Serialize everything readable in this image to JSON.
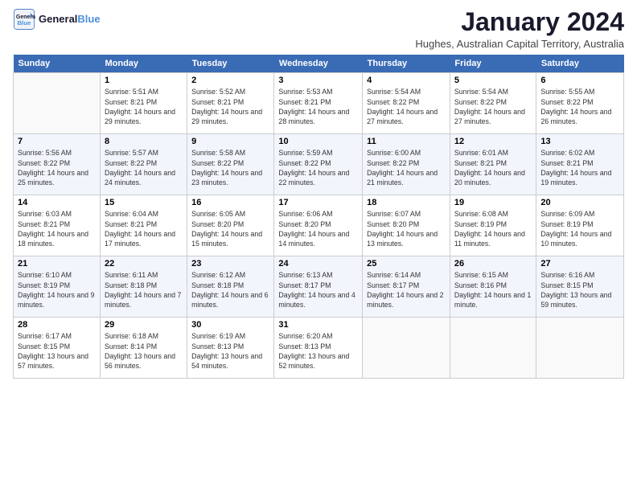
{
  "logo": {
    "text_general": "General",
    "text_blue": "Blue"
  },
  "header": {
    "title": "January 2024",
    "subtitle": "Hughes, Australian Capital Territory, Australia"
  },
  "weekdays": [
    "Sunday",
    "Monday",
    "Tuesday",
    "Wednesday",
    "Thursday",
    "Friday",
    "Saturday"
  ],
  "weeks": [
    [
      {
        "day": "",
        "empty": true
      },
      {
        "day": "1",
        "sunrise": "5:51 AM",
        "sunset": "8:21 PM",
        "daylight": "14 hours and 29 minutes."
      },
      {
        "day": "2",
        "sunrise": "5:52 AM",
        "sunset": "8:21 PM",
        "daylight": "14 hours and 29 minutes."
      },
      {
        "day": "3",
        "sunrise": "5:53 AM",
        "sunset": "8:21 PM",
        "daylight": "14 hours and 28 minutes."
      },
      {
        "day": "4",
        "sunrise": "5:54 AM",
        "sunset": "8:22 PM",
        "daylight": "14 hours and 27 minutes."
      },
      {
        "day": "5",
        "sunrise": "5:54 AM",
        "sunset": "8:22 PM",
        "daylight": "14 hours and 27 minutes."
      },
      {
        "day": "6",
        "sunrise": "5:55 AM",
        "sunset": "8:22 PM",
        "daylight": "14 hours and 26 minutes."
      }
    ],
    [
      {
        "day": "7",
        "sunrise": "5:56 AM",
        "sunset": "8:22 PM",
        "daylight": "14 hours and 25 minutes."
      },
      {
        "day": "8",
        "sunrise": "5:57 AM",
        "sunset": "8:22 PM",
        "daylight": "14 hours and 24 minutes."
      },
      {
        "day": "9",
        "sunrise": "5:58 AM",
        "sunset": "8:22 PM",
        "daylight": "14 hours and 23 minutes."
      },
      {
        "day": "10",
        "sunrise": "5:59 AM",
        "sunset": "8:22 PM",
        "daylight": "14 hours and 22 minutes."
      },
      {
        "day": "11",
        "sunrise": "6:00 AM",
        "sunset": "8:22 PM",
        "daylight": "14 hours and 21 minutes."
      },
      {
        "day": "12",
        "sunrise": "6:01 AM",
        "sunset": "8:21 PM",
        "daylight": "14 hours and 20 minutes."
      },
      {
        "day": "13",
        "sunrise": "6:02 AM",
        "sunset": "8:21 PM",
        "daylight": "14 hours and 19 minutes."
      }
    ],
    [
      {
        "day": "14",
        "sunrise": "6:03 AM",
        "sunset": "8:21 PM",
        "daylight": "14 hours and 18 minutes."
      },
      {
        "day": "15",
        "sunrise": "6:04 AM",
        "sunset": "8:21 PM",
        "daylight": "14 hours and 17 minutes."
      },
      {
        "day": "16",
        "sunrise": "6:05 AM",
        "sunset": "8:20 PM",
        "daylight": "14 hours and 15 minutes."
      },
      {
        "day": "17",
        "sunrise": "6:06 AM",
        "sunset": "8:20 PM",
        "daylight": "14 hours and 14 minutes."
      },
      {
        "day": "18",
        "sunrise": "6:07 AM",
        "sunset": "8:20 PM",
        "daylight": "14 hours and 13 minutes."
      },
      {
        "day": "19",
        "sunrise": "6:08 AM",
        "sunset": "8:19 PM",
        "daylight": "14 hours and 11 minutes."
      },
      {
        "day": "20",
        "sunrise": "6:09 AM",
        "sunset": "8:19 PM",
        "daylight": "14 hours and 10 minutes."
      }
    ],
    [
      {
        "day": "21",
        "sunrise": "6:10 AM",
        "sunset": "8:19 PM",
        "daylight": "14 hours and 9 minutes."
      },
      {
        "day": "22",
        "sunrise": "6:11 AM",
        "sunset": "8:18 PM",
        "daylight": "14 hours and 7 minutes."
      },
      {
        "day": "23",
        "sunrise": "6:12 AM",
        "sunset": "8:18 PM",
        "daylight": "14 hours and 6 minutes."
      },
      {
        "day": "24",
        "sunrise": "6:13 AM",
        "sunset": "8:17 PM",
        "daylight": "14 hours and 4 minutes."
      },
      {
        "day": "25",
        "sunrise": "6:14 AM",
        "sunset": "8:17 PM",
        "daylight": "14 hours and 2 minutes."
      },
      {
        "day": "26",
        "sunrise": "6:15 AM",
        "sunset": "8:16 PM",
        "daylight": "14 hours and 1 minute."
      },
      {
        "day": "27",
        "sunrise": "6:16 AM",
        "sunset": "8:15 PM",
        "daylight": "13 hours and 59 minutes."
      }
    ],
    [
      {
        "day": "28",
        "sunrise": "6:17 AM",
        "sunset": "8:15 PM",
        "daylight": "13 hours and 57 minutes."
      },
      {
        "day": "29",
        "sunrise": "6:18 AM",
        "sunset": "8:14 PM",
        "daylight": "13 hours and 56 minutes."
      },
      {
        "day": "30",
        "sunrise": "6:19 AM",
        "sunset": "8:13 PM",
        "daylight": "13 hours and 54 minutes."
      },
      {
        "day": "31",
        "sunrise": "6:20 AM",
        "sunset": "8:13 PM",
        "daylight": "13 hours and 52 minutes."
      },
      {
        "day": "",
        "empty": true
      },
      {
        "day": "",
        "empty": true
      },
      {
        "day": "",
        "empty": true
      }
    ]
  ],
  "labels": {
    "sunrise": "Sunrise:",
    "sunset": "Sunset:",
    "daylight": "Daylight:"
  }
}
